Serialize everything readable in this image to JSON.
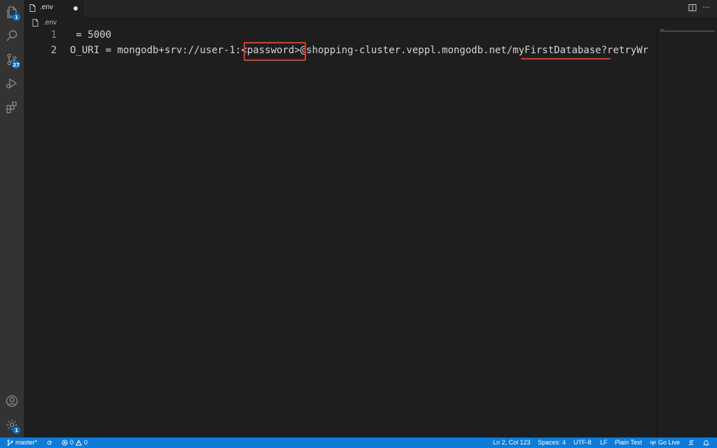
{
  "activity_bar": {
    "explorer_badge": "1",
    "source_control_badge": "27",
    "settings_badge": "1"
  },
  "tabs": [
    {
      "label": ".env",
      "dirty": true
    }
  ],
  "breadcrumb": {
    "file": ".env"
  },
  "editor": {
    "lines": [
      {
        "number": "1",
        "text": " = 5000"
      },
      {
        "number": "2",
        "text": "O_URI = mongodb+srv://user-1:<password>@shopping-cluster.veppl.mongodb.net/myFirstDatabase?retryWr"
      }
    ],
    "annotation_color": "#e0392b"
  },
  "status_bar": {
    "branch": "master*",
    "errors": "0",
    "warnings": "0",
    "cursor": "Ln 2, Col 123",
    "spaces": "Spaces: 4",
    "encoding": "UTF-8",
    "eol": "LF",
    "language": "Plain Text",
    "go_live": "Go Live",
    "background_color": "#0e7bd8"
  }
}
